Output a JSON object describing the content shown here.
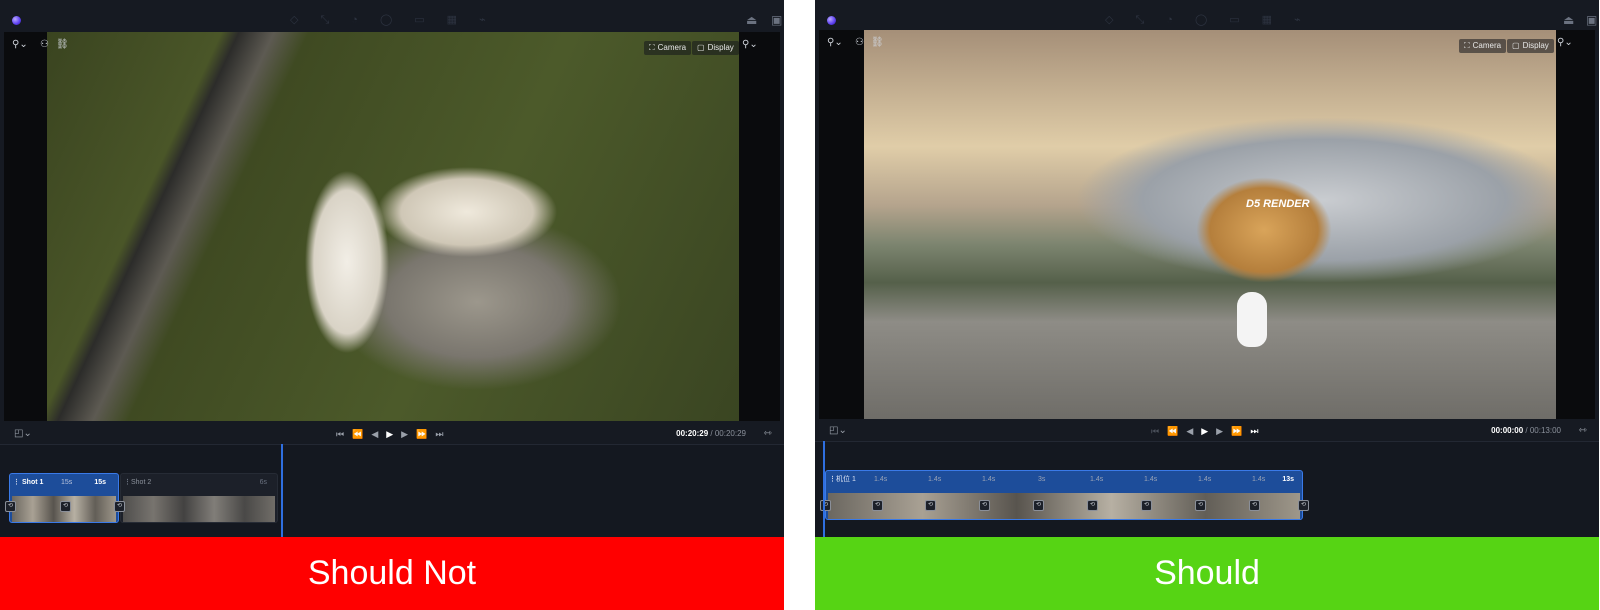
{
  "left_panel": {
    "toolbar_icons": [
      "cursor-icon",
      "move-icon",
      "paint-icon",
      "cube-icon",
      "box-icon",
      "grid-icon",
      "path-icon"
    ],
    "viewport": {
      "camera_label": "Camera",
      "display_label": "Display"
    },
    "transport": {
      "current_time": "00:20:29",
      "separator": " / ",
      "total_time": "00:20:29"
    },
    "timeline": {
      "clips": [
        {
          "label": "Shot 1",
          "segment": "15s",
          "duration": "15s",
          "selected": true
        },
        {
          "label": "Shot 2",
          "duration": "6s",
          "selected": false
        }
      ]
    },
    "verdict": "Should Not"
  },
  "right_panel": {
    "viewport": {
      "camera_label": "Camera",
      "display_label": "Display",
      "signage": "D5 RENDER"
    },
    "transport": {
      "current_time": "00:00:00",
      "separator": " / ",
      "total_time": "00:13:00"
    },
    "timeline": {
      "clip_label": "机位 1",
      "segments": [
        "1.4s",
        "1.4s",
        "1.4s",
        "3s",
        "1.4s",
        "1.4s",
        "1.4s",
        "1.4s"
      ],
      "duration": "13s"
    },
    "verdict": "Should"
  },
  "colors": {
    "panel_bg": "#161a22",
    "selection_blue": "#1d4d9a",
    "playhead": "#2f6fe0",
    "should_not": "#ff0000",
    "should": "#56d414"
  }
}
